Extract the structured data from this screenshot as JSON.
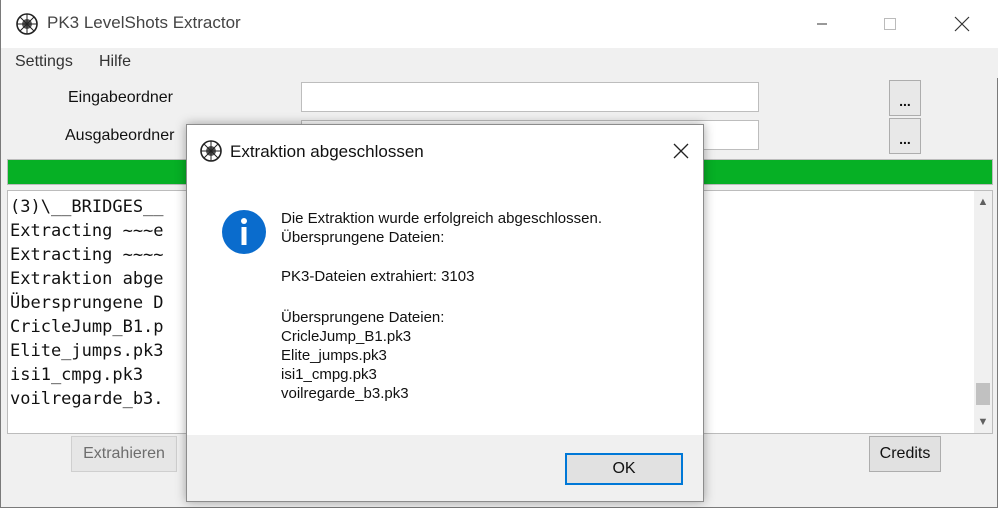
{
  "window": {
    "title": "PK3 LevelShots Extractor"
  },
  "menu": {
    "items": [
      "Settings",
      "Hilfe"
    ]
  },
  "form": {
    "input_label": "Eingabeordner",
    "input_value": "",
    "output_label": "Ausgabeordner",
    "output_value": "",
    "browse_label": "..."
  },
  "progress": {
    "value": 1.0,
    "color": "#06b025"
  },
  "log": {
    "lines": [
      "(3)\\__BRIDGES__",
      "Extracting ~~~e",
      "Extracting ~~~~",
      "Extraktion abge",
      "Übersprungene D",
      "CricleJump_B1.p",
      "Elite_jumps.pk3",
      "isi1_cmpg.pk3",
      "voilregarde_b3."
    ]
  },
  "buttons": {
    "extract": "Extrahieren",
    "credits": "Credits"
  },
  "dialog": {
    "title": "Extraktion abgeschlossen",
    "icon": "info-icon",
    "accent_color": "#0078d7",
    "message_lines": [
      "Die Extraktion wurde erfolgreich abgeschlossen.",
      "Übersprungene Dateien:",
      "PK3-Dateien extrahiert: 3103",
      "Übersprungene Dateien:",
      "CricleJump_B1.pk3",
      "Elite_jumps.pk3",
      "isi1_cmpg.pk3",
      "voilregarde_b3.pk3"
    ],
    "ok_label": "OK"
  }
}
